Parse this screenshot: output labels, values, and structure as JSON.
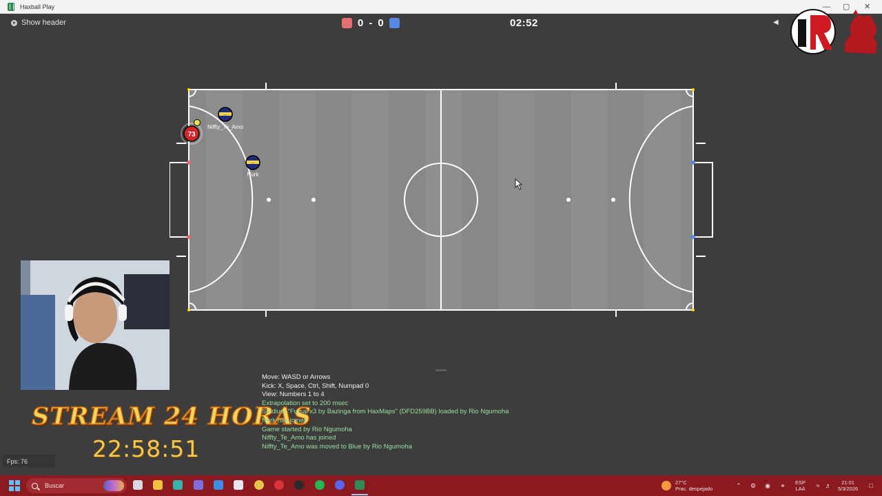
{
  "window": {
    "title": "Haxball Play",
    "minimize": "—",
    "maximize": "▢",
    "close": "✕"
  },
  "header": {
    "show_header_label": "Show header",
    "score_red": "0",
    "score_sep": "-",
    "score_blue": "0",
    "timer": "02:52",
    "volume_icon": "speaker-icon"
  },
  "colors": {
    "red_team": "#e56e6e",
    "blue_team": "#5689e5",
    "field": "#718c5a",
    "taskbar": "#8a1a1f"
  },
  "players": [
    {
      "name": "Niffty_Te_Amo",
      "avatar": "—",
      "team": "blue"
    },
    {
      "name": "Nurk",
      "avatar": "—",
      "team": "blue"
    },
    {
      "name": "",
      "avatar": "73",
      "team": "red"
    }
  ],
  "chat": {
    "help_lines": [
      "Move: WASD or Arrows",
      "Kick: X, Space, Ctrl, Shift, Numpad 0",
      "View: Numbers 1 to 4"
    ],
    "messages": [
      "Extrapolation set to 200 msec",
      "Stadium \"Futsal x3 by Bazinga from HaxMaps\" (DFD259BB) loaded by Rio Ngumoha",
      "Nurk has joined",
      "Game started by Rio Ngumoha",
      "Niffty_Te_Amo has joined",
      "Niffty_Te_Amo was moved to Blue by Rio Ngumoha"
    ]
  },
  "fps": "Fps: 76",
  "overlay": {
    "stream_title": "STREAM 24 HORAS",
    "stream_clock": "22:58:51"
  },
  "taskbar": {
    "search_label": "Buscar",
    "weather_temp": "27°C",
    "weather_desc": "Prac. despejado",
    "lang_top": "ESP",
    "lang_bottom": "LAA",
    "time": "21:01",
    "date": "5/3/2026"
  }
}
